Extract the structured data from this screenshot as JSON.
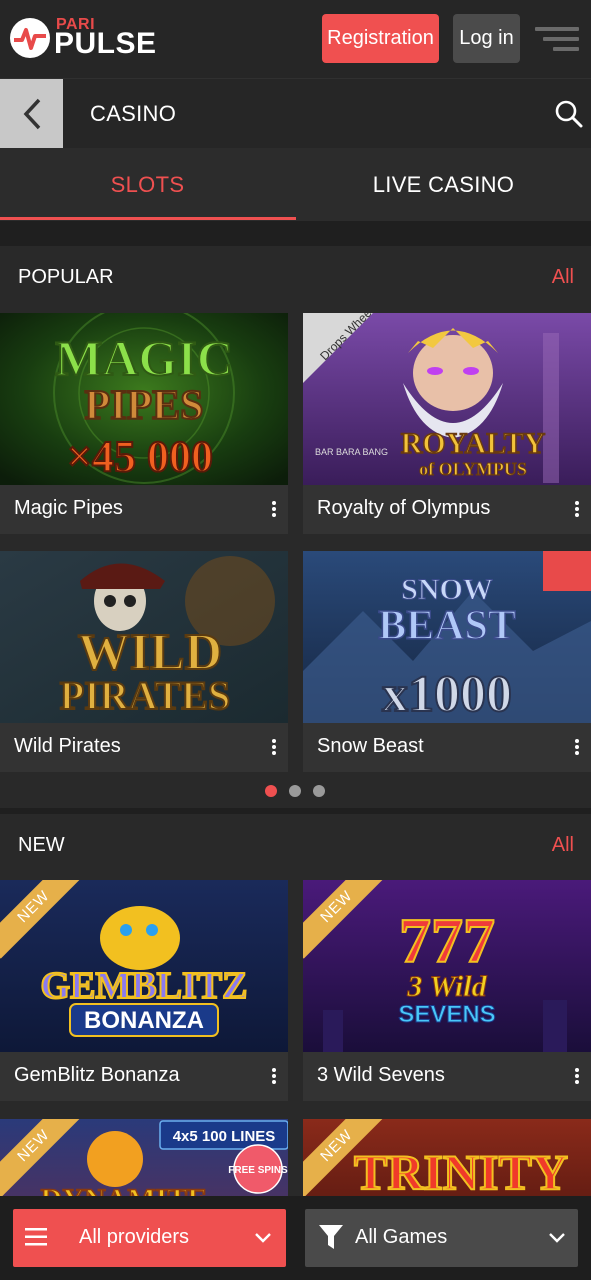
{
  "header": {
    "brand_top": "PARI",
    "brand_main": "PULSE",
    "register_label": "Registration",
    "login_label": "Log in"
  },
  "nav": {
    "title": "CASINO"
  },
  "tabs": [
    {
      "label": "SLOTS",
      "active": true
    },
    {
      "label": "LIVE CASINO",
      "active": false
    }
  ],
  "popular": {
    "heading": "POPULAR",
    "all_label": "All",
    "games": [
      {
        "name": "Magic Pipes",
        "art_title": "MAGIC",
        "art_sub": "PIPES",
        "art_extra": "×45 000"
      },
      {
        "name": "Royalty of Olympus",
        "art_title": "ROYALTY",
        "art_sub": "of OLYMPUS",
        "art_extra": "Drops Wheels",
        "art_badge": "BAR BARA BANG"
      },
      {
        "name": "Wild Pirates",
        "art_title": "WILD",
        "art_sub": "PIRATES"
      },
      {
        "name": "Snow Beast",
        "art_title": "SNOW",
        "art_sub": "BEAST",
        "art_extra": "x1000"
      }
    ],
    "pager": {
      "pages": 3,
      "active": 0
    }
  },
  "new": {
    "heading": "NEW",
    "all_label": "All",
    "games": [
      {
        "name": "GemBlitz Bonanza",
        "badge": "NEW",
        "art_title": "GEMBLITZ",
        "art_sub": "BONANZA"
      },
      {
        "name": "3 Wild Sevens",
        "badge": "NEW",
        "art_title": "777",
        "art_sub": "3 Wild",
        "art_extra": "SEVENS"
      },
      {
        "name": "",
        "badge": "NEW",
        "art_title": "DYNAMITE",
        "art_sub": "4x5 100 LINES",
        "art_extra": "FREE SPINS"
      },
      {
        "name": "",
        "badge": "NEW",
        "art_title": "TRINITY"
      }
    ]
  },
  "bottom": {
    "providers_label": "All providers",
    "games_label": "All Games"
  },
  "colors": {
    "accent": "#ef5050",
    "background": "#1f1f1f",
    "card": "#333333",
    "new_badge": "#e6b04a"
  },
  "icons": [
    "logo-icon",
    "hamburger-menu-icon",
    "back-chevron-icon",
    "search-icon",
    "more-vertical-icon",
    "list-icon",
    "chevron-down-icon",
    "filter-icon"
  ]
}
